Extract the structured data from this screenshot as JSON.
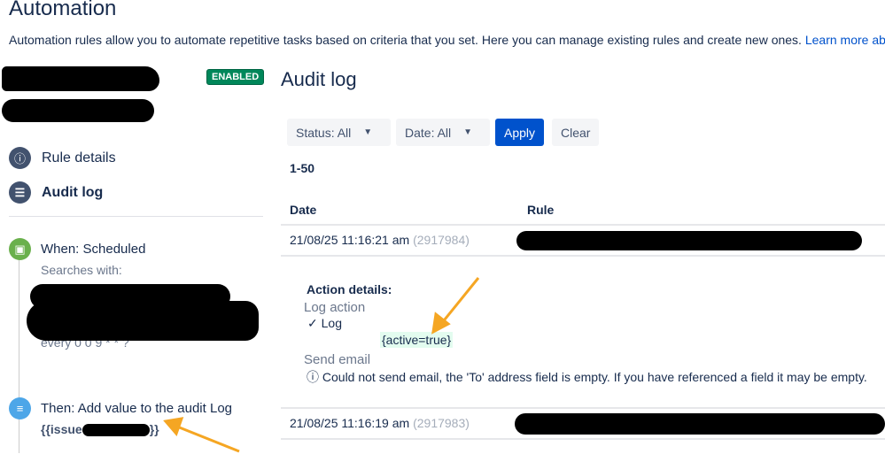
{
  "page": {
    "title": "Automation",
    "description": "Automation rules allow you to automate repetitive tasks based on criteria that you set. Here you can manage existing rules and create new ones.",
    "learn_more": "Learn more abou"
  },
  "sidebar": {
    "status_badge": "ENABLED",
    "nav": [
      {
        "label": "Rule details",
        "icon": "info-icon"
      },
      {
        "label": "Audit log",
        "icon": "list-icon"
      }
    ],
    "steps": [
      {
        "title": "When: Scheduled",
        "sub": "Searches with:",
        "cron": "every 0 0 9 * * ?",
        "icon": "calendar-icon"
      },
      {
        "title": "Then: Add value to the audit Log",
        "value_prefix": "{{issue",
        "value_suffix": "}}",
        "icon": "log-icon"
      }
    ]
  },
  "main": {
    "heading": "Audit log",
    "filters": {
      "status": "Status: All",
      "date": "Date: All",
      "apply": "Apply",
      "clear": "Clear"
    },
    "range": "1-50",
    "columns": [
      "Date",
      "Rule"
    ],
    "rows": [
      {
        "date": "21/08/25 11:16:21 am",
        "id": "(2917984)"
      },
      {
        "date": "21/08/25 11:16:19 am",
        "id": "(2917983)"
      }
    ],
    "details": {
      "heading": "Action details:",
      "log_action": "Log action",
      "log": "✓ Log",
      "value": "{active=true}",
      "send_email": "Send email",
      "error": "Could not send email, the 'To' address field is empty. If you have referenced a field it may be empty."
    }
  },
  "colors": {
    "accent": "#0052cc",
    "enabled": "#00875a",
    "arrow": "#f5a623"
  }
}
